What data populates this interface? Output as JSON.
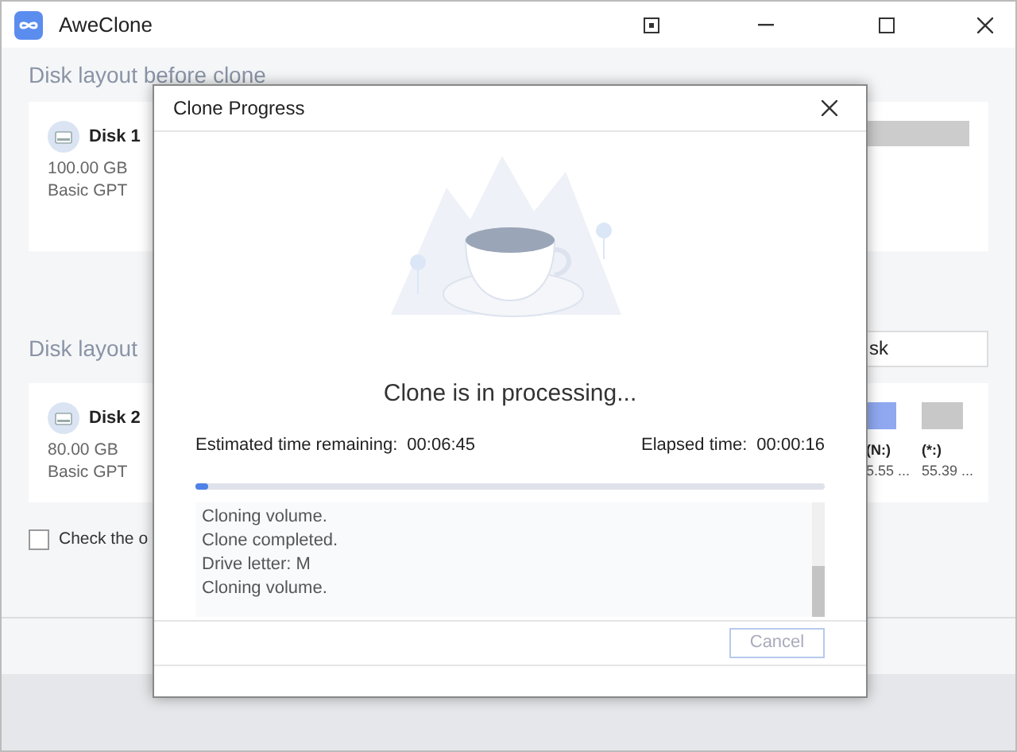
{
  "window": {
    "title": "AweClone"
  },
  "before": {
    "heading": "Disk layout before clone",
    "disk": {
      "name": "Disk 1",
      "size": "100.00 GB",
      "type": "Basic GPT"
    }
  },
  "after": {
    "heading": "Disk layout",
    "edit_button": "sk",
    "disk": {
      "name": "Disk 2",
      "size": "80.00 GB",
      "type": "Basic GPT"
    },
    "partitions": [
      {
        "label": "(N:)",
        "size": "5.55 ...",
        "color": "#8fa8f0"
      },
      {
        "label": "(*:)",
        "size": "55.39 ...",
        "color": "#c8c8c8"
      }
    ]
  },
  "check_option": {
    "label": "Check the o",
    "checked": false
  },
  "dialog": {
    "title": "Clone Progress",
    "status": "Clone is in processing...",
    "remaining_label": "Estimated time remaining:",
    "remaining": "00:06:45",
    "elapsed_label": "Elapsed time:",
    "elapsed": "00:00:16",
    "level": 0.02,
    "log": [
      "Cloning volume.",
      "Clone completed.",
      "Drive letter: M",
      "Cloning volume."
    ],
    "cancel_button": "Cancel"
  }
}
